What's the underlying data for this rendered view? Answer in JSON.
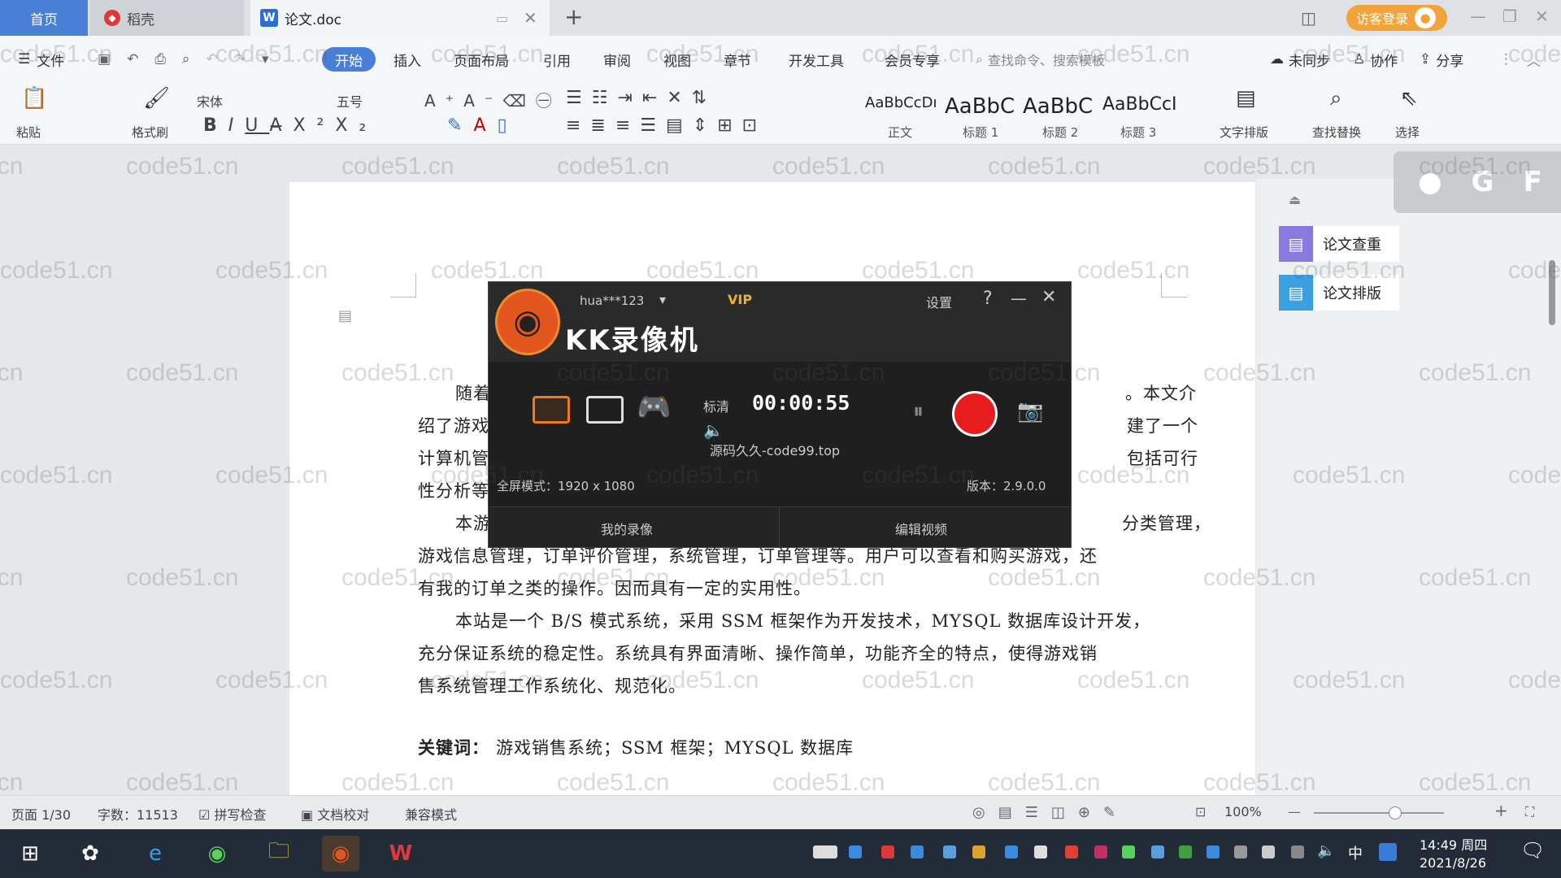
{
  "tabs": {
    "home": "首页",
    "daoke": "稻壳",
    "doc": "论文.doc",
    "new_tab": "+"
  },
  "login_label": "访客登录",
  "menu": {
    "file": "文件",
    "start": "开始",
    "insert": "插入",
    "layout": "页面布局",
    "reference": "引用",
    "review": "审阅",
    "view": "视图",
    "chapter": "章节",
    "devtools": "开发工具",
    "member": "会员专享",
    "search": "查找命令、搜索模板",
    "unsync": "未同步",
    "collab": "协作",
    "share": "分享"
  },
  "ribbon": {
    "paste": "粘贴",
    "format_painter": "格式刷",
    "font": "宋体",
    "size": "五号",
    "styles": [
      {
        "preview": "AaBbCcDı",
        "label": "正文"
      },
      {
        "preview": "AaBbC",
        "label": "标题 1"
      },
      {
        "preview": "AaBbC",
        "label": "标题 2"
      },
      {
        "preview": "AaBbCcI",
        "label": "标题 3"
      }
    ],
    "text_tools": "文字排版",
    "find_replace": "查找替换",
    "select": "选择"
  },
  "side": {
    "check": "论文查重",
    "format": "论文排版"
  },
  "doc": {
    "p1": [
      "随着",
      "。本文介",
      "绍了游戏",
      "建了一个",
      "计算机管",
      "包括可行",
      "性分析等"
    ],
    "p2_start": "本游",
    "p2_end": "分类管理，",
    "p2_line2": "游戏信息管理，订单评价管理，系统管理，订单管理等。用户可以查看和购买游戏，还",
    "p2_line3": "有我的订单之类的操作。因而具有一定的实用性。",
    "p3_line1": "本站是一个 B/S 模式系统，采用 SSM 框架作为开发技术，MYSQL 数据库设计开发，",
    "p3_line2": "充分保证系统的稳定性。系统具有界面清晰、操作简单，功能齐全的特点，使得游戏销",
    "p3_line3": "售系统管理工作系统化、规范化。",
    "keywords_label": "关键词：",
    "keywords": "游戏销售系统；SSM 框架；MYSQL 数据库"
  },
  "recorder": {
    "user": "hua***123",
    "vip": "VIP",
    "settings": "设置",
    "help": "?",
    "title": "KK录像机",
    "quality": "标清",
    "timer": "00:00:55",
    "watermark_text": "源码久久-code99.top",
    "mode": "全屏模式：1920 x 1080",
    "version": "版本：2.9.0.0",
    "my_recordings": "我的录像",
    "edit_video": "编辑视频"
  },
  "status": {
    "page": "页面 1/30",
    "words": "字数：11513",
    "spell": "拼写检查",
    "proof": "文档校对",
    "compat": "兼容模式",
    "zoom": "100%"
  },
  "taskbar": {
    "time": "14:49 周四",
    "date": "2021/8/26",
    "ime": "中"
  },
  "watermark": "code51.cn",
  "colors": {
    "accent": "#4a7fd8",
    "record": "#e81c1c",
    "login": "#f2a43a"
  }
}
